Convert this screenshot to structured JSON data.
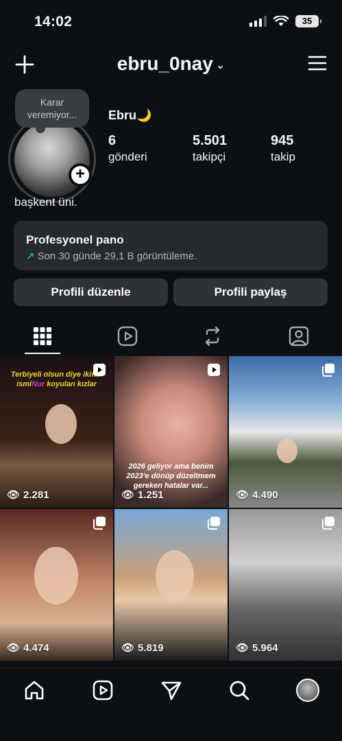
{
  "status": {
    "time": "14:02",
    "battery": "35"
  },
  "header": {
    "username": "ebru_0nay",
    "chevron": "⌄"
  },
  "profile": {
    "note": "Karar veremiyor...",
    "name": "Ebru🌙",
    "bio": "başkent üni.",
    "stats": [
      {
        "value": "6",
        "label": "gönderi"
      },
      {
        "value": "5.501",
        "label": "takipçi"
      },
      {
        "value": "945",
        "label": "takip"
      }
    ]
  },
  "pro_panel": {
    "title": "Profesyonel pano",
    "subtitle": "Son 30 günde 29,1 B görüntüleme."
  },
  "buttons": {
    "edit": "Profili düzenle",
    "share": "Profili paylaş"
  },
  "tabs": [
    "grid-icon",
    "reels-icon",
    "reposts-icon",
    "tagged-icon"
  ],
  "posts": [
    {
      "views": "2.281",
      "type": "reel",
      "caption_parts": [
        "Terbiyeli olsun diye ikinci",
        "ismi",
        "Nur",
        "koyulan kızlar"
      ]
    },
    {
      "views": "1.251",
      "type": "reel",
      "caption": "2026 geliyor ama benim 2023'e dönüp düzeltmem gereken hatalar var..."
    },
    {
      "views": "4.490",
      "type": "carousel"
    },
    {
      "views": "4.474",
      "type": "carousel"
    },
    {
      "views": "5.819",
      "type": "carousel"
    },
    {
      "views": "5.964",
      "type": "carousel"
    }
  ],
  "nav": [
    "home-icon",
    "reels-icon",
    "direct-message-icon",
    "search-icon",
    "profile-avatar"
  ]
}
